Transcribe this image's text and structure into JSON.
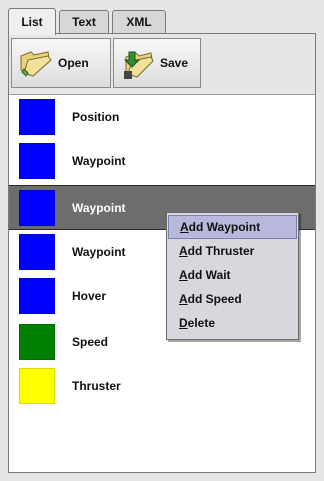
{
  "tabs": [
    {
      "label": "List",
      "active": true
    },
    {
      "label": "Text",
      "active": false
    },
    {
      "label": "XML",
      "active": false
    }
  ],
  "toolbar": {
    "open_label": "Open",
    "save_label": "Save",
    "open_icon": "folder-open-icon",
    "save_icon": "folder-save-icon"
  },
  "list": {
    "items": [
      {
        "label": "Position",
        "color": "#0000ff",
        "selected": false
      },
      {
        "label": "Waypoint",
        "color": "#0000ff",
        "selected": false
      },
      {
        "label": "Waypoint",
        "color": "#0000ff",
        "selected": true
      },
      {
        "label": "Waypoint",
        "color": "#0000ff",
        "selected": false
      },
      {
        "label": "Hover",
        "color": "#0000ff",
        "selected": false
      },
      {
        "label": "Speed",
        "color": "#008000",
        "selected": false
      },
      {
        "label": "Thruster",
        "color": "#ffff00",
        "selected": false
      }
    ]
  },
  "context_menu": {
    "items": [
      {
        "first": "A",
        "rest": "dd Waypoint",
        "highlighted": true
      },
      {
        "first": "A",
        "rest": "dd Thruster",
        "highlighted": false
      },
      {
        "first": "A",
        "rest": "dd Wait",
        "highlighted": false
      },
      {
        "first": "A",
        "rest": "dd Speed",
        "highlighted": false
      },
      {
        "first": "D",
        "rest": "elete",
        "highlighted": false
      }
    ]
  },
  "colors": {
    "selection_bg": "#6d6d6d",
    "menu_bg": "#d7d7dd",
    "menu_highlight": "#b7b8dc"
  }
}
